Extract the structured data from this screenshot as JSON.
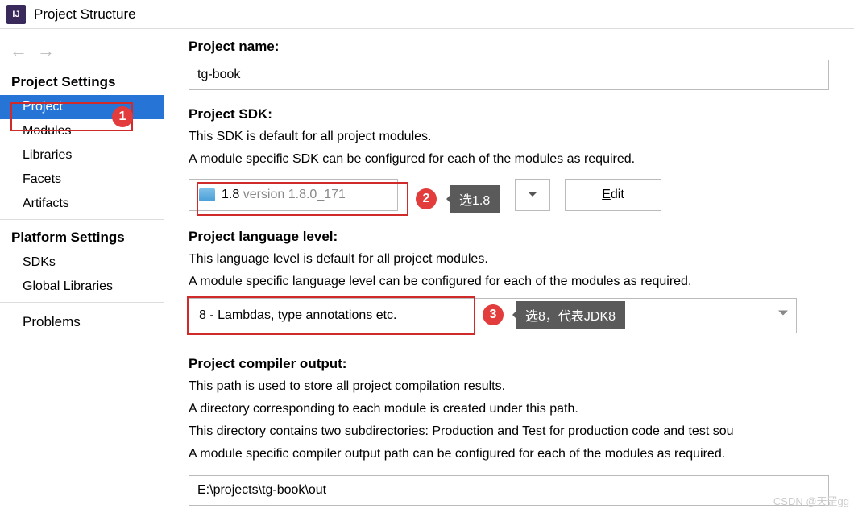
{
  "window": {
    "title": "Project Structure",
    "app_icon_text": "IJ"
  },
  "nav": {
    "back": "←",
    "forward": "→"
  },
  "sidebar": {
    "section1_header": "Project Settings",
    "items1": [
      "Project",
      "Modules",
      "Libraries",
      "Facets",
      "Artifacts"
    ],
    "section2_header": "Platform Settings",
    "items2": [
      "SDKs",
      "Global Libraries"
    ],
    "problems": "Problems"
  },
  "project": {
    "name_label": "Project name:",
    "name_value": "tg-book",
    "sdk_label": "Project SDK:",
    "sdk_desc1": "This SDK is default for all project modules.",
    "sdk_desc2": "A module specific SDK can be configured for each of the modules as required.",
    "sdk_main": "1.8",
    "sdk_version": "version 1.8.0_171",
    "edit_label": "Edit",
    "lang_label": "Project language level:",
    "lang_desc1": "This language level is default for all project modules.",
    "lang_desc2": "A module specific language level can be configured for each of the modules as required.",
    "lang_value": "8 - Lambdas, type annotations etc.",
    "out_label": "Project compiler output:",
    "out_desc1": "This path is used to store all project compilation results.",
    "out_desc2": "A directory corresponding to each module is created under this path.",
    "out_desc3": "This directory contains two subdirectories: Production and Test for production code and test sou",
    "out_desc4": "A module specific compiler output path can be configured for each of the modules as required.",
    "out_value": "E:\\projects\\tg-book\\out"
  },
  "callouts": {
    "c1_num": "1",
    "c2_num": "2",
    "c2_tip": "选1.8",
    "c3_num": "3",
    "c3_tip": "选8，代表JDK8"
  },
  "watermark": "CSDN @天罡gg"
}
